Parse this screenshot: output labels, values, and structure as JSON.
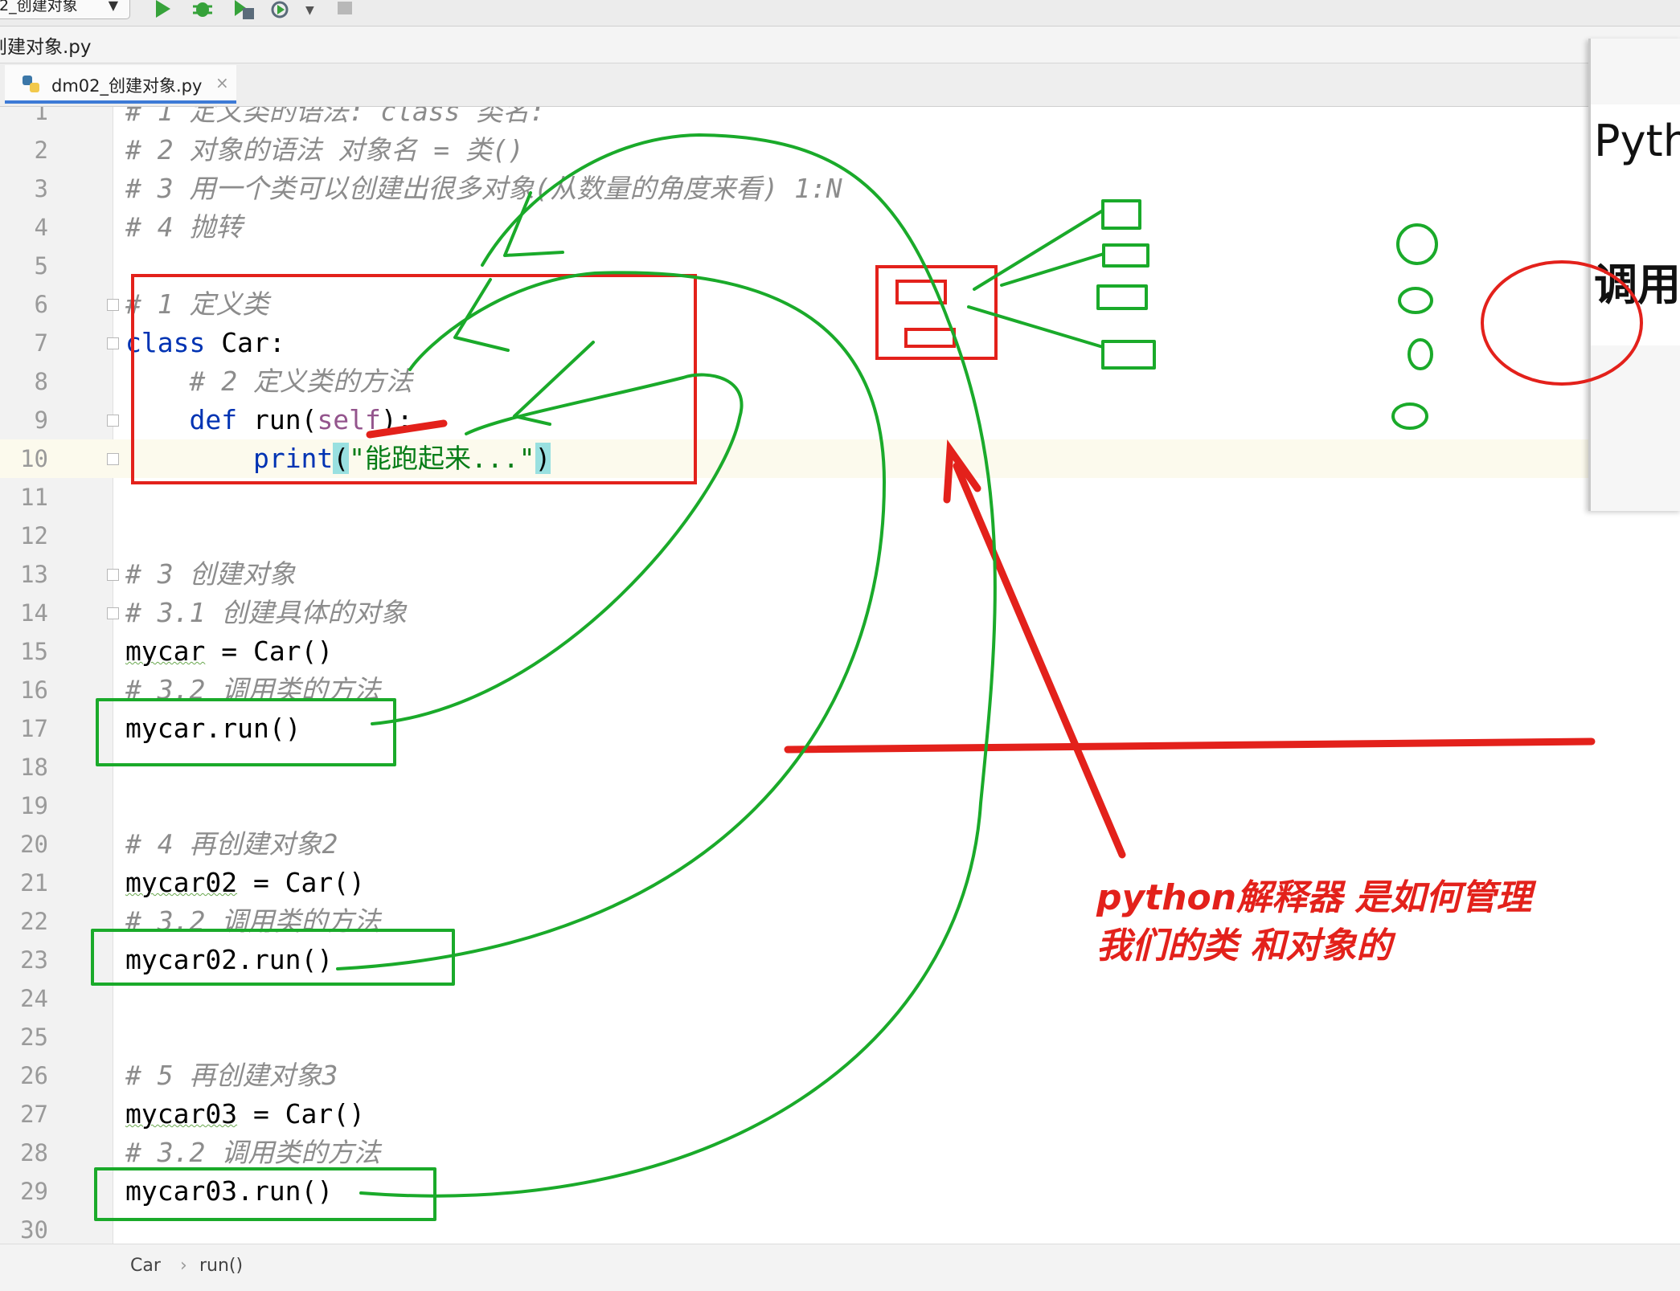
{
  "toolbar": {
    "run_config_label": "2_创建对象",
    "icons": [
      "play-icon",
      "debug-icon",
      "coverage-icon",
      "profile-icon",
      "stop-icon"
    ]
  },
  "breadcrumb_top": "创建对象.py",
  "tab": {
    "label": "dm02_创建对象.py",
    "close": "×"
  },
  "lines": [
    {
      "n": "1",
      "text": "# 1 定义类的语法: class 类名:",
      "type": "comment"
    },
    {
      "n": "2",
      "text": "# 2 对象的语法 对象名 = 类()",
      "type": "comment"
    },
    {
      "n": "3",
      "text": "# 3 用一个类可以创建出很多对象(从数量的角度来看) 1:N",
      "type": "comment"
    },
    {
      "n": "4",
      "text": "# 4 抛转",
      "type": "comment"
    },
    {
      "n": "5",
      "text": "",
      "type": "blank"
    },
    {
      "n": "6",
      "text": "# 1 定义类",
      "type": "comment"
    },
    {
      "n": "7",
      "text": "class Car:",
      "type": "code"
    },
    {
      "n": "8",
      "text": "    # 2 定义类的方法",
      "type": "comment"
    },
    {
      "n": "9",
      "text": "    def run(self):",
      "type": "code"
    },
    {
      "n": "10",
      "text": "        print(\"能跑起来...\")",
      "type": "code"
    },
    {
      "n": "11",
      "text": "",
      "type": "blank"
    },
    {
      "n": "12",
      "text": "",
      "type": "blank"
    },
    {
      "n": "13",
      "text": "# 3 创建对象",
      "type": "comment"
    },
    {
      "n": "14",
      "text": "# 3.1 创建具体的对象",
      "type": "comment"
    },
    {
      "n": "15",
      "text": "mycar = Car()",
      "type": "code"
    },
    {
      "n": "16",
      "text": "# 3.2 调用类的方法",
      "type": "comment"
    },
    {
      "n": "17",
      "text": "mycar.run()",
      "type": "code"
    },
    {
      "n": "18",
      "text": "",
      "type": "blank"
    },
    {
      "n": "19",
      "text": "",
      "type": "blank"
    },
    {
      "n": "20",
      "text": "# 4 再创建对象2",
      "type": "comment"
    },
    {
      "n": "21",
      "text": "mycar02 = Car()",
      "type": "code"
    },
    {
      "n": "22",
      "text": "# 3.2 调用类的方法",
      "type": "comment"
    },
    {
      "n": "23",
      "text": "mycar02.run()",
      "type": "code"
    },
    {
      "n": "24",
      "text": "",
      "type": "blank"
    },
    {
      "n": "25",
      "text": "",
      "type": "blank"
    },
    {
      "n": "26",
      "text": "# 5 再创建对象3",
      "type": "comment"
    },
    {
      "n": "27",
      "text": "mycar03 = Car()",
      "type": "code"
    },
    {
      "n": "28",
      "text": "# 3.2 调用类的方法",
      "type": "comment"
    },
    {
      "n": "29",
      "text": "mycar03.run()",
      "type": "code"
    },
    {
      "n": "30",
      "text": "",
      "type": "blank"
    }
  ],
  "current_line": 10,
  "annotation_note": [
    "python解释器 是如何管理",
    "我们的类 和对象的"
  ],
  "status_breadcrumb": {
    "class": "Car",
    "separator": "›",
    "method": "run()"
  },
  "side_panel": {
    "line1": "Pytho",
    "line2": "调用"
  },
  "colors": {
    "annotation_red": "#e3211b",
    "annotation_green": "#1aaa2a",
    "keyword": "#0033b3",
    "string": "#067d17",
    "comment": "#8c8c8c"
  }
}
